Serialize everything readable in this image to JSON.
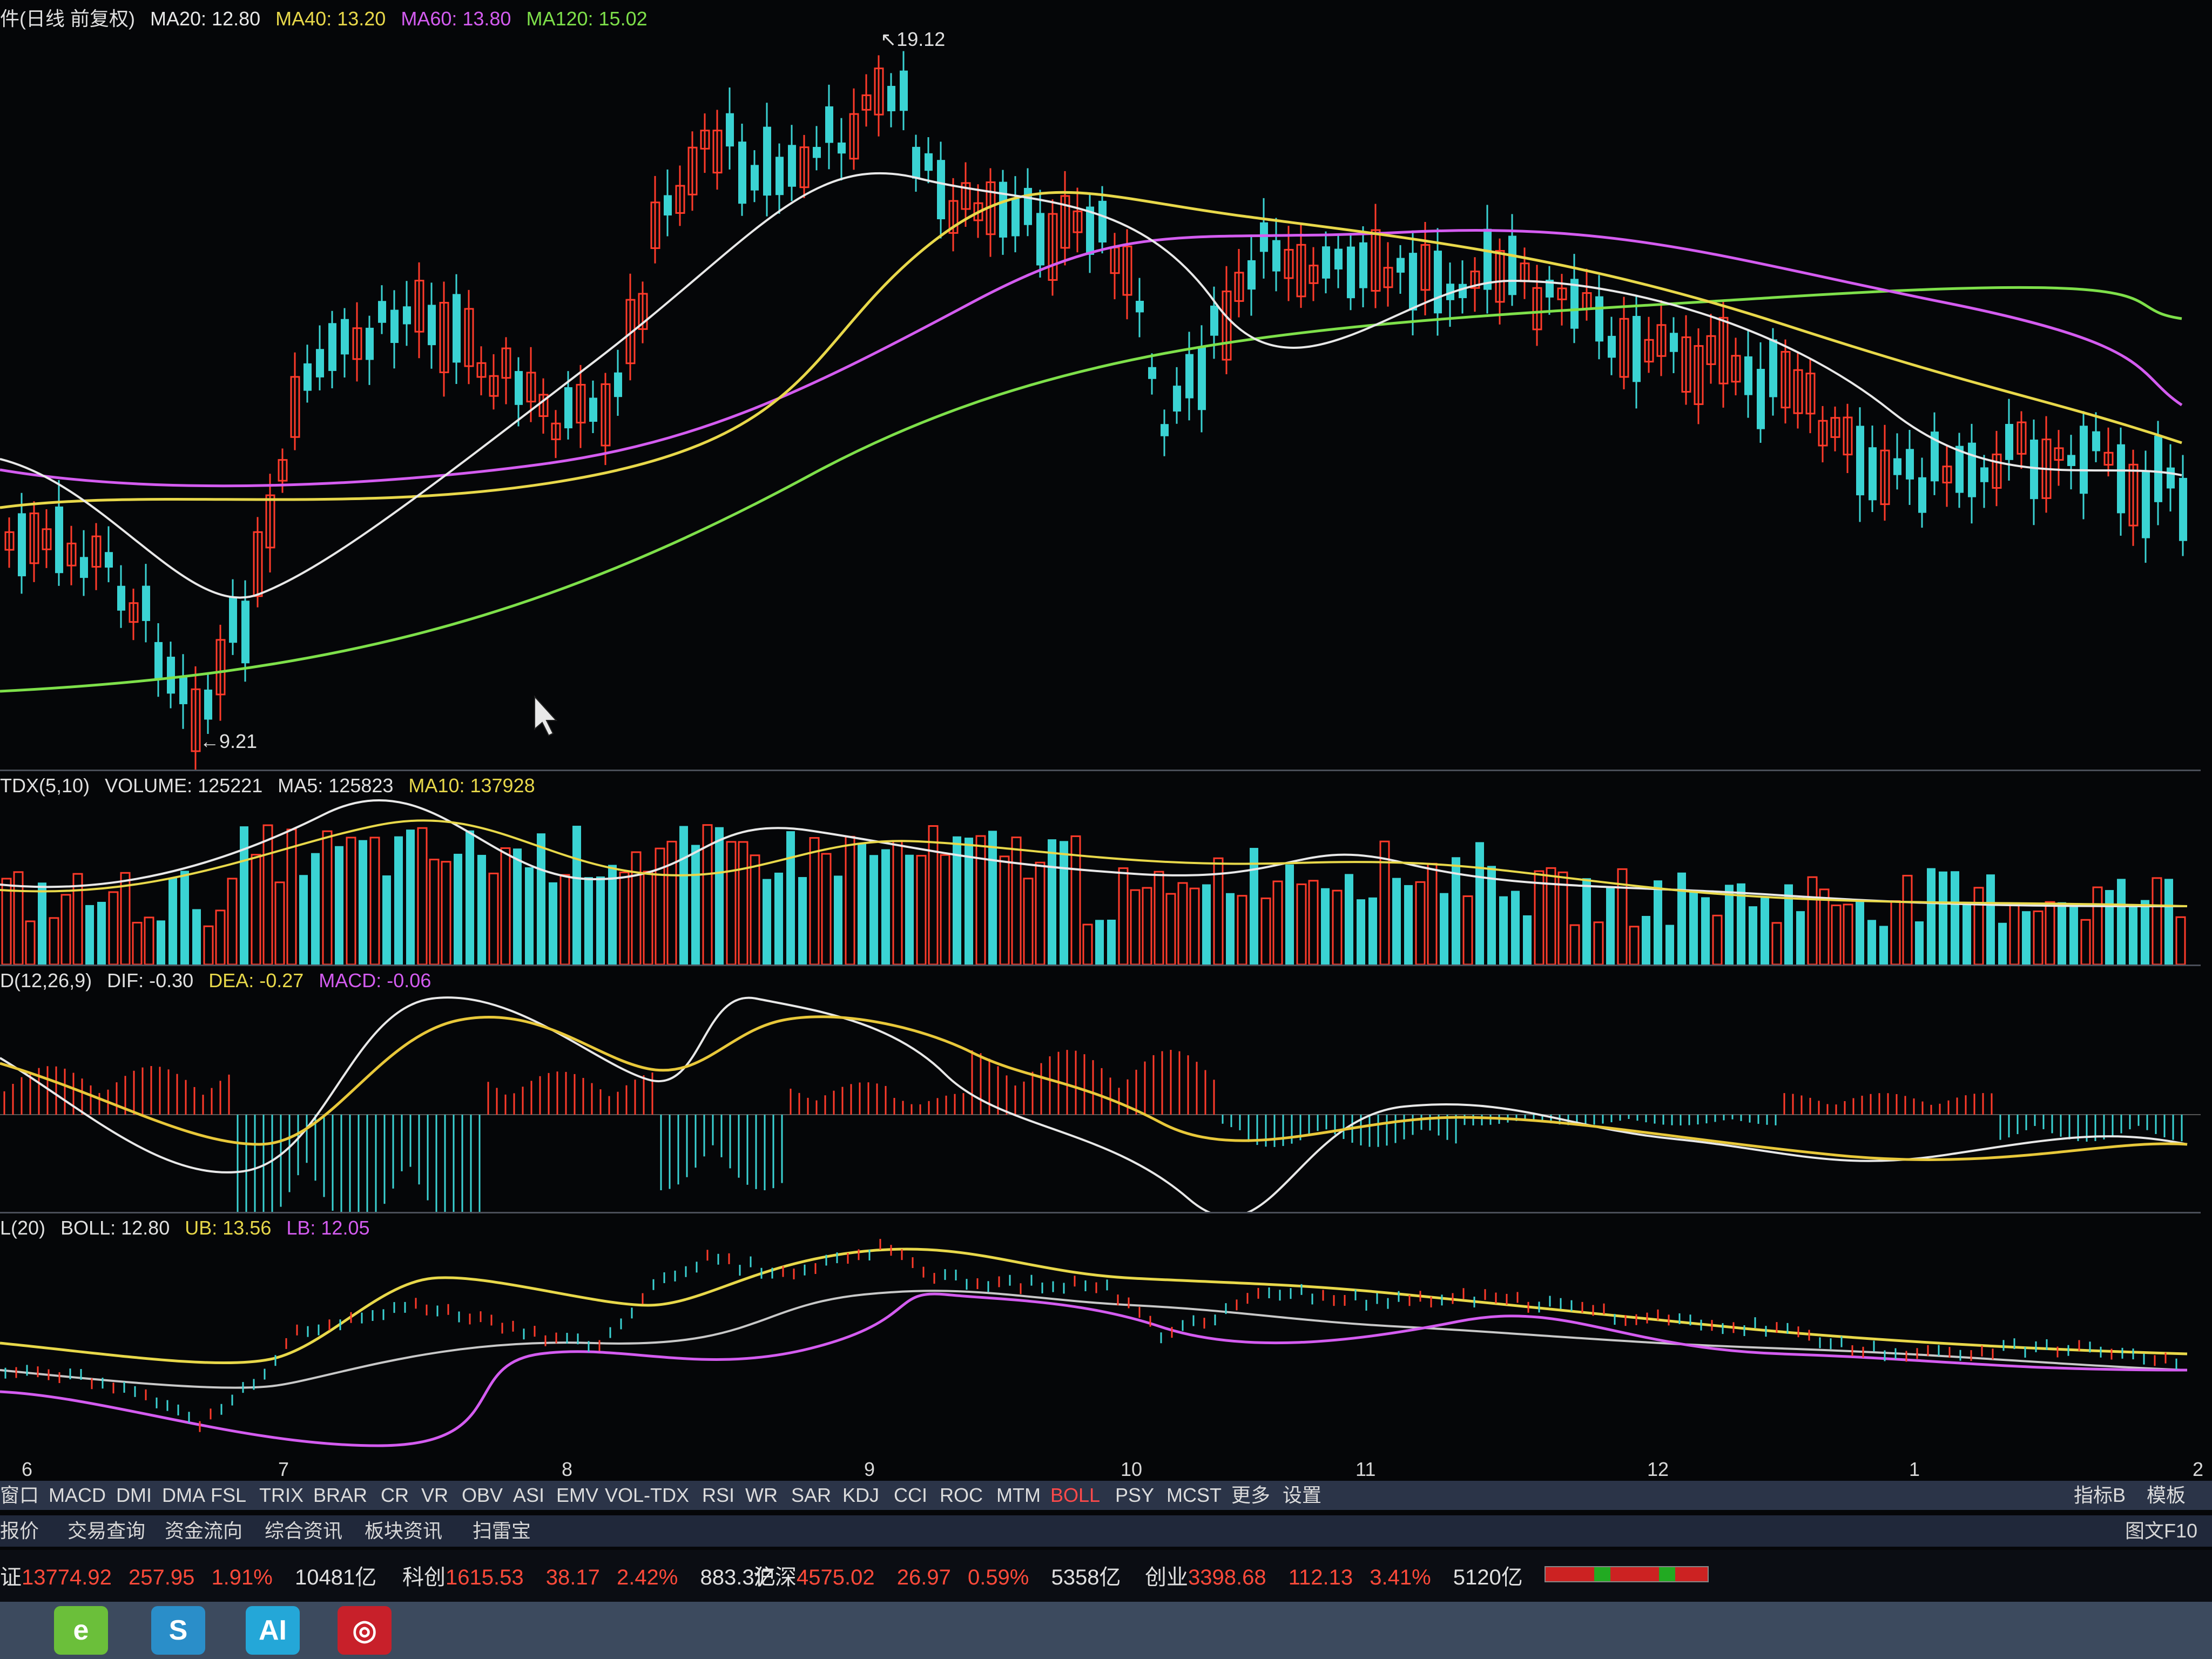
{
  "main_legend": {
    "title": "件(日线 前复权)",
    "items": [
      {
        "label": "MA20: 12.80",
        "color": "#e8e8e8"
      },
      {
        "label": "MA40: 13.20",
        "color": "#e8d84a"
      },
      {
        "label": "MA60: 13.80",
        "color": "#d45cf0"
      },
      {
        "label": "MA120: 15.02",
        "color": "#7ee04a"
      }
    ]
  },
  "annotations": {
    "high": "19.12",
    "low": "9.21"
  },
  "volume_legend": {
    "prefix": "TDX(5,10)",
    "volume": "VOLUME: 125221",
    "ma5": "MA5: 125823",
    "ma10": "MA10: 137928"
  },
  "macd_legend": {
    "prefix": "D(12,26,9)",
    "dif": "DIF: -0.30",
    "dea": "DEA: -0.27",
    "macd": "MACD: -0.06"
  },
  "boll_legend": {
    "prefix": "L(20)",
    "boll": "BOLL: 12.80",
    "ub": "UB: 13.56",
    "lb": "LB: 12.05"
  },
  "month_labels": [
    "6",
    "7",
    "8",
    "9",
    "10",
    "11",
    "12",
    "1",
    "2"
  ],
  "indicator_tabs": [
    "窗口",
    "MACD",
    "DMI",
    "DMA",
    "FSL",
    "TRIX",
    "BRAR",
    "CR",
    "VR",
    "OBV",
    "ASI",
    "EMV",
    "VOL-TDX",
    "RSI",
    "WR",
    "SAR",
    "KDJ",
    "CCI",
    "ROC",
    "MTM",
    "BOLL",
    "PSY",
    "MCST",
    "更多",
    "设置"
  ],
  "active_tab": "BOLL",
  "right_tabs": [
    "指标B",
    "模板"
  ],
  "info_tabs": [
    "报价",
    "交易查询",
    "资金流向",
    "综合资讯",
    "板块资讯",
    "扫雷宝"
  ],
  "f10_label": "图文F10",
  "index_bar": [
    {
      "name": "证",
      "value": "13774.92",
      "change": "257.95",
      "pct": "1.91%",
      "amount": "10481亿"
    },
    {
      "name": "科创",
      "value": "1615.53",
      "change": "38.17",
      "pct": "2.42%",
      "amount": "883.3亿"
    },
    {
      "name": "沪深",
      "value": "4575.02",
      "change": "26.97",
      "pct": "0.59%",
      "amount": "5358亿"
    },
    {
      "name": "创业",
      "value": "3398.68",
      "change": "112.13",
      "pct": "3.41%",
      "amount": "5120亿"
    }
  ],
  "taskbar_apps": [
    {
      "name": "browser-e",
      "label": "e",
      "color": "#6bbf3a"
    },
    {
      "name": "search-s",
      "label": "S",
      "color": "#2a8ec9"
    },
    {
      "name": "ai",
      "label": "AI",
      "color": "#24a7d8"
    },
    {
      "name": "citic",
      "label": "◎",
      "color": "#c8202a"
    }
  ],
  "colors": {
    "up": "#ff3b2a",
    "down": "#3ad3d3",
    "ma20": "#e8e8e8",
    "ma40": "#e8d84a",
    "ma60": "#d45cf0",
    "ma120": "#7ee04a"
  }
}
